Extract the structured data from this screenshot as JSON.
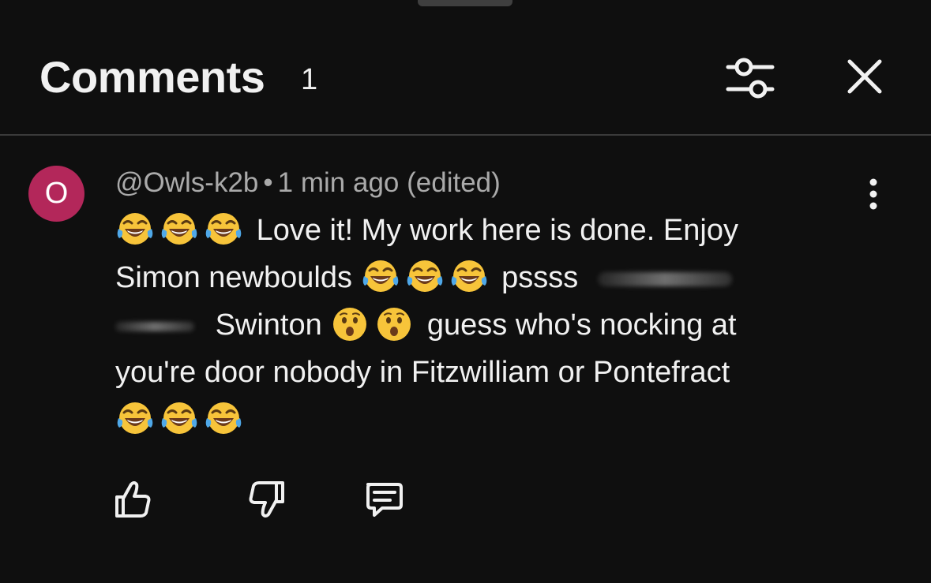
{
  "header": {
    "title": "Comments",
    "count": "1"
  },
  "icons": {
    "filter": "sliders-icon",
    "close": "close-icon",
    "more": "more-vertical-icon",
    "like": "thumbs-up-icon",
    "dislike": "thumbs-down-icon",
    "reply": "reply-icon",
    "laughing": "laughing-tears-emoji",
    "surprised": "surprised-face-emoji"
  },
  "comment": {
    "avatar_letter": "O",
    "avatar_color": "#b3275a",
    "author": "@Owls-k2b",
    "separator": "•",
    "time": "1 min ago (edited)",
    "text_1": "Love it! My work here is done. Enjoy",
    "text_2": "Simon newboulds",
    "text_3": "pssss",
    "text_4": "Swinton",
    "text_5": "guess who's nocking at",
    "text_6": "you're door nobody in Fitzwilliam or Pontefract"
  },
  "colors": {
    "background": "#0f0f0f",
    "primary_text": "#f1f1f1",
    "secondary_text": "#aaaaaa",
    "divider": "#3a3a3a"
  }
}
